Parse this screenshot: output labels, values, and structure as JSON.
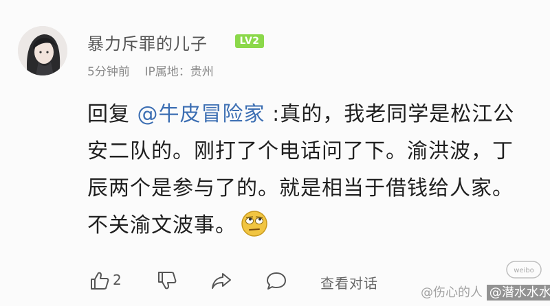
{
  "comment": {
    "username": "暴力斥罪的儿子",
    "level": "LV2",
    "timestamp": "5分钟前",
    "ip_location": "IP属地：贵州",
    "reply_prefix": "回复 ",
    "mention": "@牛皮冒险家",
    "text": " :真的，我老同学是松江公安二队的。刚打了个电话问了下。渝洪波，丁辰两个是参与了的。就是相当于借钱给人家。不关渝文波事。",
    "emoji": "rolling-eyes-emoji"
  },
  "actions": {
    "like_count": "2",
    "view_thread_label": "查看对话",
    "icons": [
      "thumbs-up-icon",
      "thumbs-down-icon",
      "share-icon",
      "comment-icon"
    ]
  },
  "watermark": {
    "text": "@伤心的人",
    "handle": "@潜水水水"
  }
}
